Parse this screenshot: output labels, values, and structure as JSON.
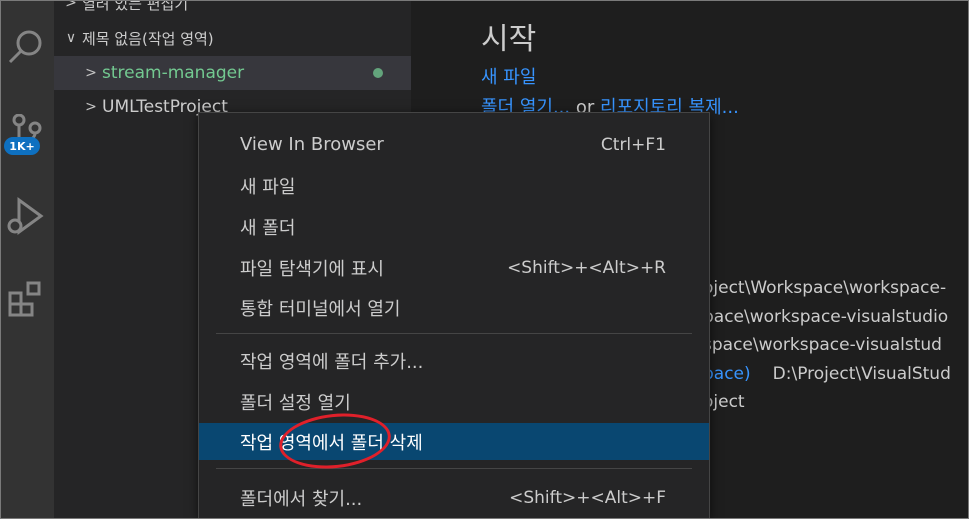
{
  "activity_bar": {
    "icons": [
      "search-icon",
      "source-control-icon",
      "run-debug-icon",
      "extensions-icon"
    ],
    "scm_badge": "1K+",
    "badge_color": "#0e70c0"
  },
  "explorer": {
    "partial_top_item": "열려 있는 편집기",
    "workspace_root": "제목 없음(작업 영역)",
    "folders": [
      {
        "label": "stream-manager",
        "color": "#73c991",
        "modified": true
      },
      {
        "label": "UMLTestProject"
      }
    ]
  },
  "welcome": {
    "title": "시작",
    "new_file": "새 파일",
    "open_folder": "폴더 열기...",
    "or_text": "or",
    "clone_repo": "리포지토리 복제...",
    "recent": [
      {
        "path": "oject\\Workspace\\workspace-"
      },
      {
        "path": "pace\\workspace-visualstudio"
      },
      {
        "path": "space\\workspace-visualstud"
      },
      {
        "link": "pace)",
        "path": "D:\\Project\\VisualStud"
      },
      {
        "path": "oject"
      }
    ]
  },
  "context_menu": {
    "items": [
      {
        "label": "View In Browser",
        "shortcut": "Ctrl+F1"
      },
      {
        "label": "새 파일",
        "shortcut": ""
      },
      {
        "label": "새 폴더",
        "shortcut": ""
      },
      {
        "label": "파일 탐색기에 표시",
        "shortcut": "<Shift>+<Alt>+R"
      },
      {
        "label": "통합 터미널에서 열기",
        "shortcut": ""
      },
      {
        "label": "작업 영역에 폴더 추가...",
        "shortcut": ""
      },
      {
        "label": "폴더 설정 열기",
        "shortcut": ""
      },
      {
        "label": "작업 영역에서 폴더 삭제",
        "shortcut": "",
        "selected": true
      },
      {
        "label": "폴더에서 찾기...",
        "shortcut": "<Shift>+<Alt>+F"
      }
    ],
    "selected_color": "#094771",
    "annotation_color": "#e0202a"
  }
}
